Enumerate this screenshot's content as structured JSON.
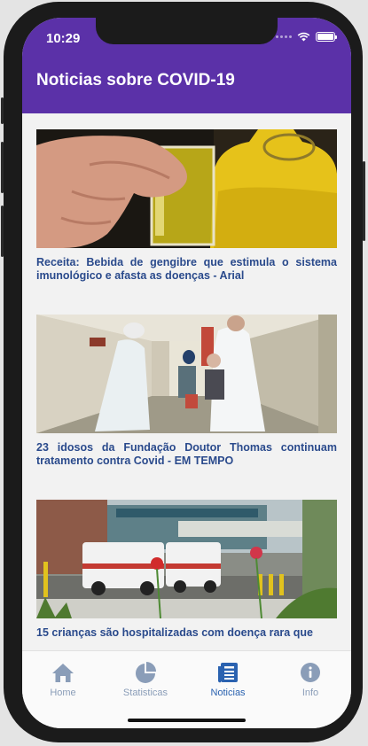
{
  "status_bar": {
    "time": "10:29"
  },
  "header": {
    "title": "Noticias sobre COVID-19",
    "color": "#5b31a8"
  },
  "news": [
    {
      "title": "Receita: Bebida de gengibre que estimula o sistema imunológico e afasta as doenças - Arial",
      "image_icon": "ginger-drink-photo"
    },
    {
      "title": "23 idosos da Fundação Doutor Thomas continuam tratamento contra Covid - EM TEMPO",
      "image_icon": "hospital-corridor-photo"
    },
    {
      "title": "15 crianças são hospitalizadas com doença rara que",
      "image_icon": "ambulances-photo"
    }
  ],
  "tabs": [
    {
      "label": "Home",
      "icon": "home-icon"
    },
    {
      "label": "Statisticas",
      "icon": "pie-chart-icon"
    },
    {
      "label": "Noticias",
      "icon": "news-icon",
      "active": true
    },
    {
      "label": "Info",
      "icon": "info-icon"
    }
  ],
  "colors": {
    "tab_active": "#2a62b0",
    "tab_inactive": "#8a9db8",
    "news_title": "#2a4a8c"
  }
}
